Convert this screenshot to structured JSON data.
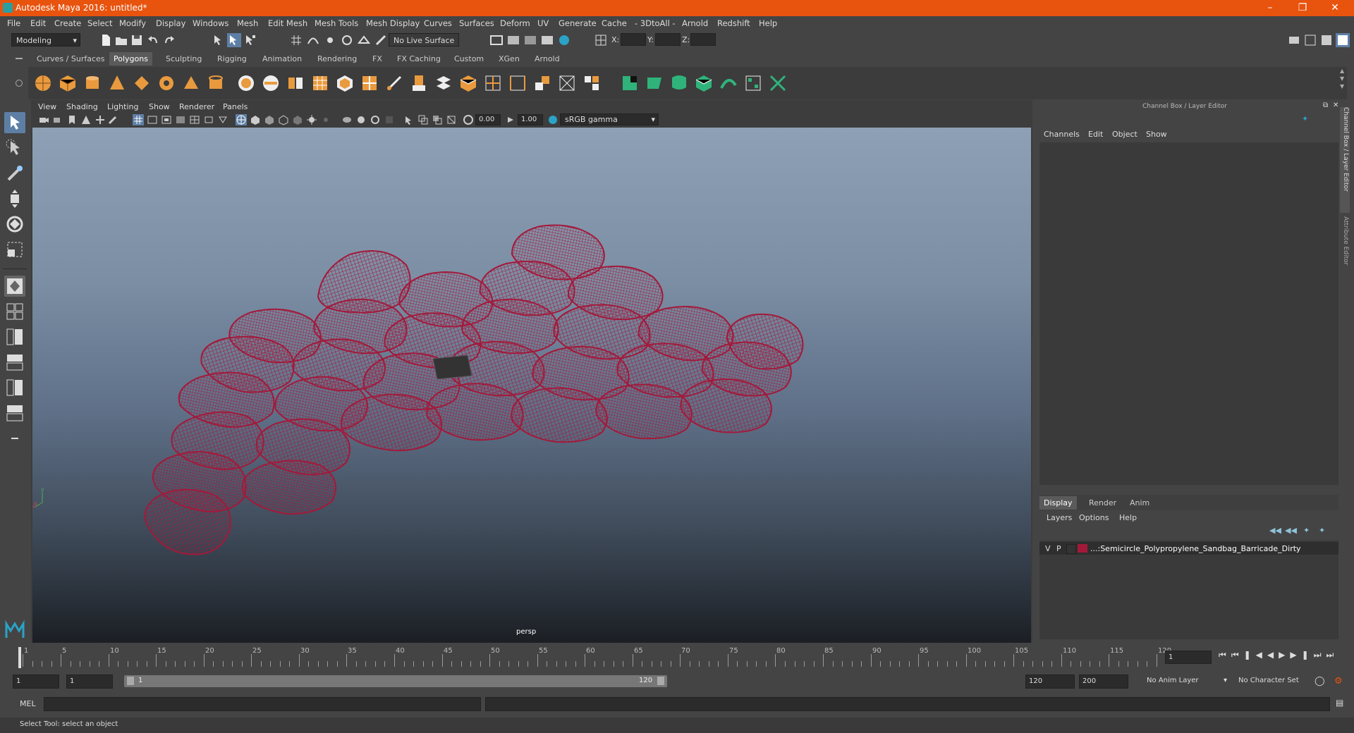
{
  "window": {
    "title": "Autodesk Maya 2016: untitled*"
  },
  "menus": [
    "File",
    "Edit",
    "Create",
    "Select",
    "Modify",
    "Display",
    "Windows",
    "Mesh",
    "Edit Mesh",
    "Mesh Tools",
    "Mesh Display",
    "Curves",
    "Surfaces",
    "Deform",
    "UV",
    "Generate",
    "Cache",
    "- 3DtoAll -",
    "Arnold",
    "Redshift",
    "Help"
  ],
  "status": {
    "mode": "Modeling",
    "live_surface": "No Live Surface",
    "x_label": "X:",
    "y_label": "Y:",
    "z_label": "Z:"
  },
  "shelf_tabs": [
    "Curves / Surfaces",
    "Polygons",
    "Sculpting",
    "Rigging",
    "Animation",
    "Rendering",
    "FX",
    "FX Caching",
    "Custom",
    "XGen",
    "Arnold"
  ],
  "shelf_active": "Polygons",
  "viewport": {
    "menus": [
      "View",
      "Shading",
      "Lighting",
      "Show",
      "Renderer",
      "Panels"
    ],
    "exposure": "0.00",
    "gamma": "1.00",
    "color_space": "sRGB gamma",
    "camera": "persp"
  },
  "channel_box": {
    "title": "Channel Box / Layer Editor",
    "menus": [
      "Channels",
      "Edit",
      "Object",
      "Show"
    ],
    "side_tabs": [
      "Channel Box / Layer Editor",
      "Attribute Editor"
    ]
  },
  "layer_editor": {
    "tabs": [
      "Display",
      "Render",
      "Anim"
    ],
    "active_tab": "Display",
    "menus": [
      "Layers",
      "Options",
      "Help"
    ],
    "layers": [
      {
        "v": "V",
        "p": "P",
        "color": "#a3193a",
        "name": "...:Semicircle_Polypropylene_Sandbag_Barricade_Dirty"
      }
    ]
  },
  "timeline": {
    "ticks": [
      "1",
      "5",
      "10",
      "15",
      "20",
      "25",
      "30",
      "35",
      "40",
      "45",
      "50",
      "55",
      "60",
      "65",
      "70",
      "75",
      "80",
      "85",
      "90",
      "95",
      "100",
      "105",
      "110",
      "115",
      "120"
    ],
    "current_frame": "1"
  },
  "range": {
    "start": "1",
    "playback_start": "1",
    "slider_start": "1",
    "slider_end": "120",
    "playback_end": "120",
    "end": "200",
    "anim_layer": "No Anim Layer",
    "character_set": "No Character Set"
  },
  "command": {
    "label": "MEL"
  },
  "help_line": "Select Tool: select an object",
  "colors": {
    "title_bar": "#e8530e",
    "wireframe": "#a3193a",
    "selected_tool": "#5e7fa5"
  }
}
